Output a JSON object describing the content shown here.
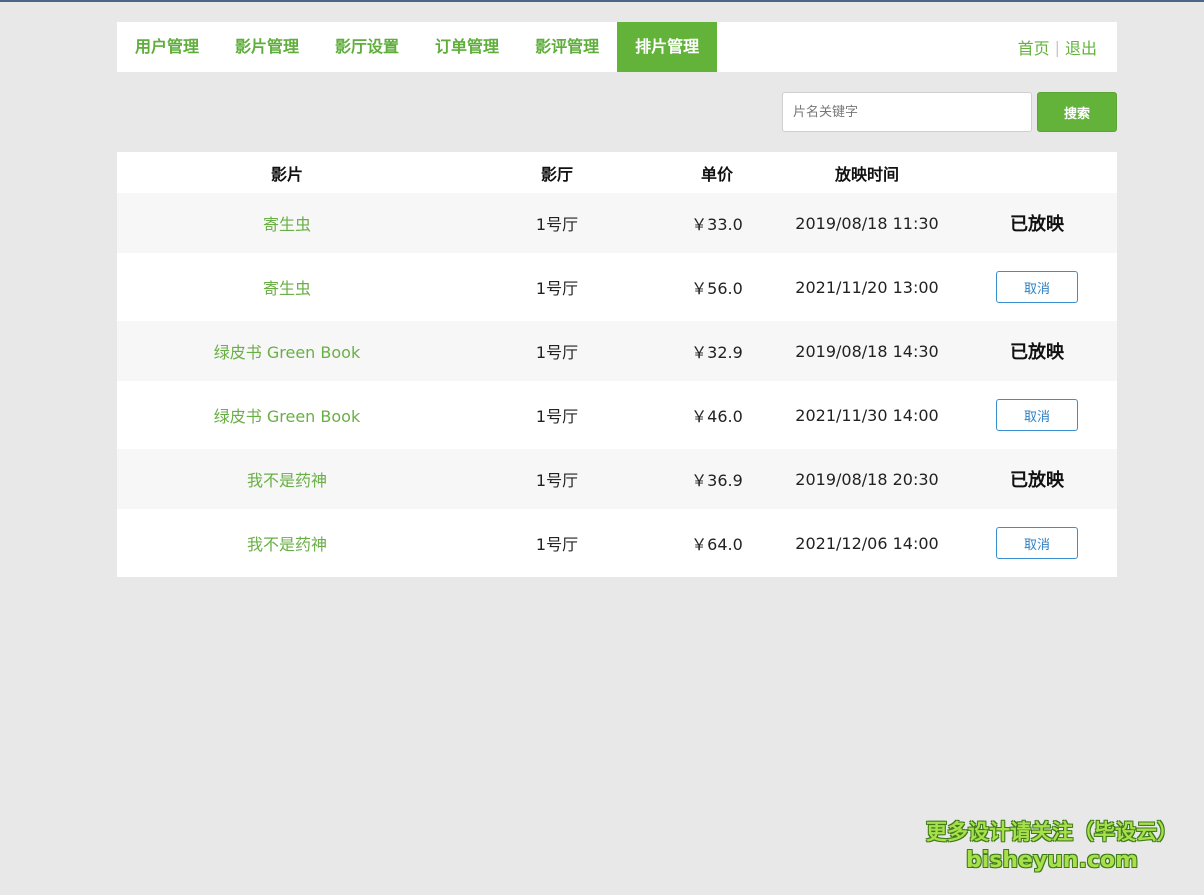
{
  "nav": {
    "tabs": [
      {
        "label": "用户管理",
        "active": false
      },
      {
        "label": "影片管理",
        "active": false
      },
      {
        "label": "影厅设置",
        "active": false
      },
      {
        "label": "订单管理",
        "active": false
      },
      {
        "label": "影评管理",
        "active": false
      },
      {
        "label": "排片管理",
        "active": true
      }
    ],
    "home_label": "首页",
    "separator": "|",
    "logout_label": "退出"
  },
  "search": {
    "placeholder": "片名关键字",
    "value": "",
    "button_label": "搜索"
  },
  "table": {
    "headers": [
      "影片",
      "影厅",
      "单价",
      "放映时间",
      ""
    ],
    "rows": [
      {
        "movie": "寄生虫",
        "hall": "1号厅",
        "price": "￥33.0",
        "time": "2019/08/18 11:30",
        "status": "已放映",
        "action": ""
      },
      {
        "movie": "寄生虫",
        "hall": "1号厅",
        "price": "￥56.0",
        "time": "2021/11/20 13:00",
        "status": "",
        "action": "取消"
      },
      {
        "movie": "绿皮书 Green Book",
        "hall": "1号厅",
        "price": "￥32.9",
        "time": "2019/08/18 14:30",
        "status": "已放映",
        "action": ""
      },
      {
        "movie": "绿皮书 Green Book",
        "hall": "1号厅",
        "price": "￥46.0",
        "time": "2021/11/30 14:00",
        "status": "",
        "action": "取消"
      },
      {
        "movie": "我不是药神",
        "hall": "1号厅",
        "price": "￥36.9",
        "time": "2019/08/18 20:30",
        "status": "已放映",
        "action": ""
      },
      {
        "movie": "我不是药神",
        "hall": "1号厅",
        "price": "￥64.0",
        "time": "2021/12/06 14:00",
        "status": "",
        "action": "取消"
      }
    ]
  },
  "watermark": {
    "line1": "更多设计请关注（毕设云）",
    "line2": "bisheyun.com"
  },
  "colors": {
    "accent": "#63b33b",
    "background": "#e8e8e8",
    "cancel_border": "#3a8fd0"
  }
}
